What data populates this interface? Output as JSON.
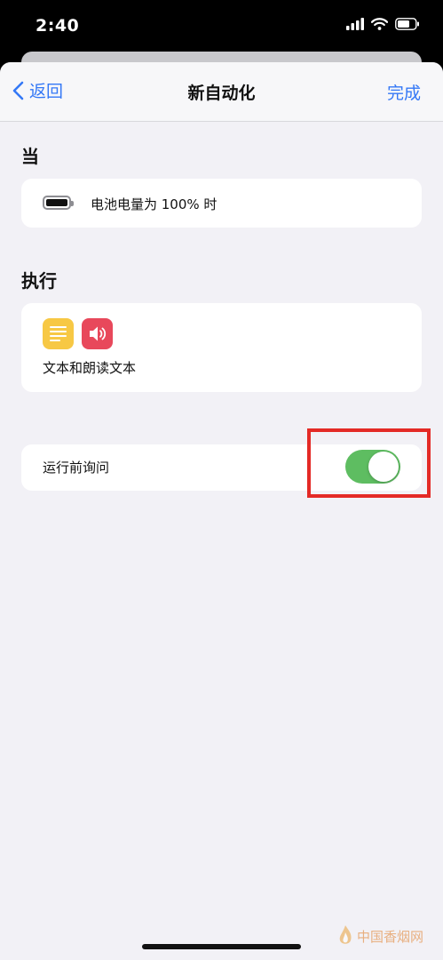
{
  "status_bar": {
    "time": "2:40"
  },
  "navbar": {
    "back_label": "返回",
    "title": "新自动化",
    "done_label": "完成"
  },
  "when_section": {
    "header": "当",
    "trigger_text": "电池电量为 100% 时"
  },
  "do_section": {
    "header": "执行",
    "actions_text": "文本和朗读文本",
    "action_icons": [
      "text-icon",
      "speaker-icon"
    ]
  },
  "ask_before_running": {
    "label": "运行前询问",
    "enabled": true
  },
  "colors": {
    "accent": "#3478f6",
    "toggle_on": "#5ebd61",
    "highlight": "#e42a26",
    "text_icon_bg": "#f7c844",
    "speak_icon_bg": "#e8485b"
  },
  "watermark": {
    "text": "中国香烟网"
  }
}
